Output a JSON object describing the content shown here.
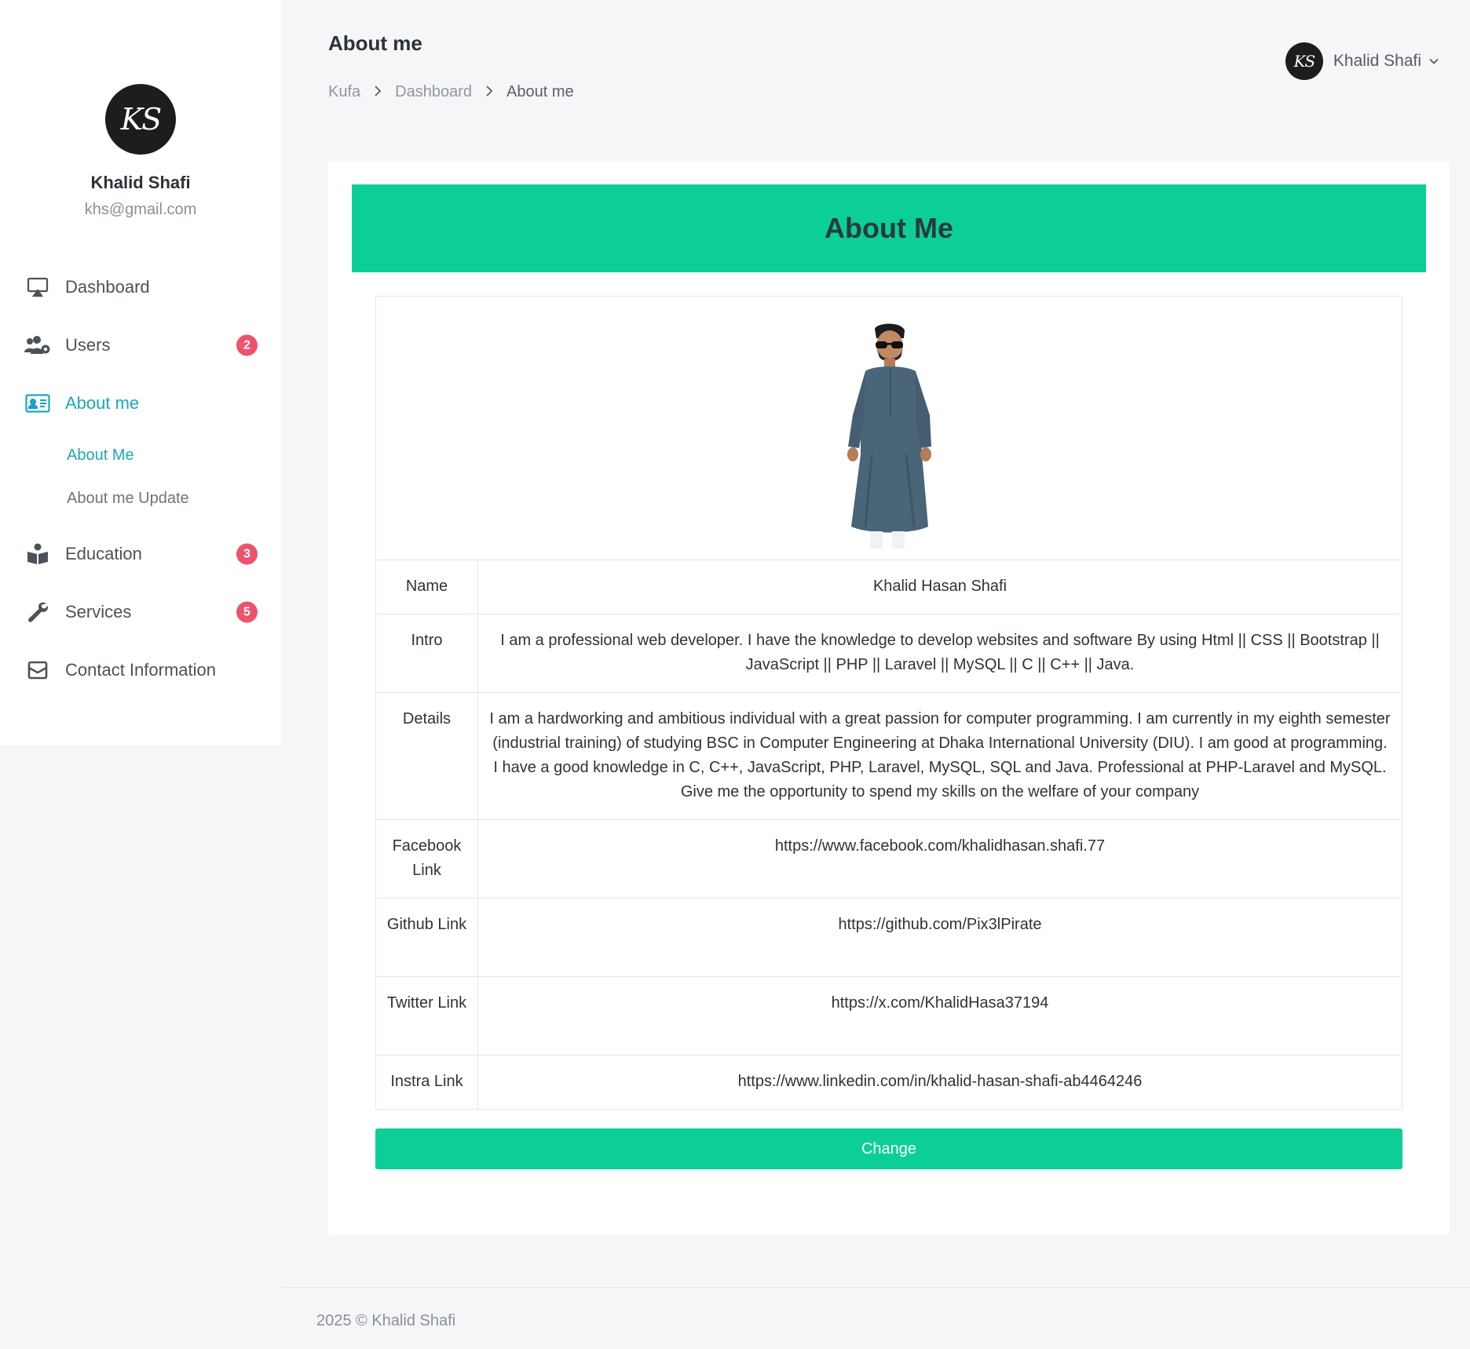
{
  "profile": {
    "avatar_text": "KS",
    "name": "Khalid Shafi",
    "email": "khs@gmail.com"
  },
  "nav": {
    "items": [
      {
        "label": "Dashboard",
        "icon": "monitor-icon"
      },
      {
        "label": "Users",
        "icon": "users-gear-icon",
        "badge": "2"
      },
      {
        "label": "About me",
        "icon": "id-card-icon",
        "active": true
      },
      {
        "label": "Education",
        "icon": "book-reader-icon",
        "badge": "3"
      },
      {
        "label": "Services",
        "icon": "wrench-icon",
        "badge": "5"
      },
      {
        "label": "Contact Information",
        "icon": "envelope-icon"
      }
    ],
    "about_sub": [
      {
        "label": "About Me",
        "active": true
      },
      {
        "label": "About me Update"
      }
    ]
  },
  "header": {
    "title": "About me",
    "breadcrumb": [
      "Kufa",
      "Dashboard",
      "About me"
    ]
  },
  "user_menu": {
    "avatar_text": "KS",
    "name": "Khalid Shafi"
  },
  "card": {
    "title": "About Me",
    "rows": [
      {
        "key": "Name",
        "value": "Khalid Hasan Shafi"
      },
      {
        "key": "Intro",
        "value": "I am a professional web developer. I have the knowledge to develop websites and software By using Html || CSS || Bootstrap || JavaScript || PHP || Laravel || MySQL || C || C++ || Java."
      },
      {
        "key": "Details",
        "value": "I am a hardworking and ambitious individual with a great passion for computer programming. I am currently in my eighth semester (industrial training) of studying BSC in Computer Engineering at Dhaka International University (DIU). I am good at programming. I have a good knowledge in C, C++, JavaScript, PHP, Laravel, MySQL, SQL and Java. Professional at PHP-Laravel and MySQL. Give me the opportunity to spend my skills on the welfare of your company"
      },
      {
        "key": "Facebook Link",
        "value": "https://www.facebook.com/khalidhasan.shafi.77"
      },
      {
        "key": "Github Link",
        "value": "https://github.com/Pix3lPirate"
      },
      {
        "key": "Twitter Link",
        "value": "https://x.com/KhalidHasa37194"
      },
      {
        "key": "Instra Link",
        "value": "https://www.linkedin.com/in/khalid-hasan-shafi-ab4464246"
      }
    ],
    "button_label": "Change"
  },
  "footer": {
    "text": "2025 © Khalid Shafi"
  },
  "colors": {
    "accent": "#0ccf96",
    "active_link": "#1ba6bf",
    "badge": "#ec536c"
  }
}
